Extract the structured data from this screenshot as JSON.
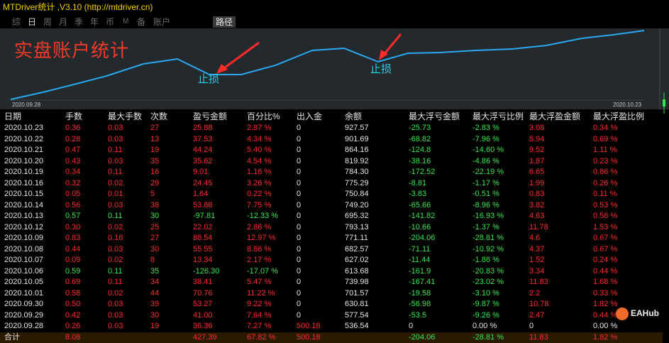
{
  "app_title": "MTDriver统计 ,V3.10 (http://mtdriver.cn)",
  "tabs": [
    "综",
    "日",
    "周",
    "月",
    "季",
    "年",
    "币",
    "M",
    "备",
    "账户",
    "路径"
  ],
  "active_tab": "日",
  "chart": {
    "title": "实盘账户统计",
    "stop_label_1": "止损",
    "stop_label_2": "止损",
    "start_date": "2020.09.28",
    "end_date": "2020.10.23",
    "line_color": "#2aa8f0",
    "arrow_color": "#ff2a2a"
  },
  "table": {
    "headers": [
      "日期",
      "手数",
      "最大手数",
      "次数",
      "盈亏金额",
      "百分比%",
      "出入金",
      "余额",
      "最大浮亏金额",
      "最大浮亏比例",
      "最大浮盈金额",
      "最大浮盈比例"
    ],
    "rows": [
      [
        "2020.10.23",
        "0.36",
        "0.03",
        "27",
        "25.88",
        "2.87 %",
        "0",
        "927.57",
        "-25.73",
        "-2.83 %",
        "3.08",
        "0.34 %"
      ],
      [
        "2020.10.22",
        "0.28",
        "0.03",
        "13",
        "37.53",
        "4.34 %",
        "0",
        "901.69",
        "-68.82",
        "-7.96 %",
        "5.94",
        "0.69 %"
      ],
      [
        "2020.10.21",
        "0.47",
        "0.11",
        "19",
        "44.24",
        "5.40 %",
        "0",
        "864.16",
        "-124.8",
        "-14.60 %",
        "9.52",
        "1.11 %"
      ],
      [
        "2020.10.20",
        "0.43",
        "0.03",
        "35",
        "35.62",
        "4.54 %",
        "0",
        "819.92",
        "-38.16",
        "-4.86 %",
        "1.87",
        "0.23 %"
      ],
      [
        "2020.10.19",
        "0.34",
        "0.11",
        "16",
        "9.01",
        "1.16 %",
        "0",
        "784.30",
        "-172.52",
        "-22.19 %",
        "6.65",
        "0.86 %"
      ],
      [
        "2020.10.16",
        "0.32",
        "0.02",
        "29",
        "24.45",
        "3.26 %",
        "0",
        "775.29",
        "-8.81",
        "-1.17 %",
        "1.99",
        "0.26 %"
      ],
      [
        "2020.10.15",
        "0.05",
        "0.01",
        "5",
        "1.64",
        "0.22 %",
        "0",
        "750.84",
        "-3.83",
        "-0.51 %",
        "0.83",
        "0.11 %"
      ],
      [
        "2020.10.14",
        "0.56",
        "0.03",
        "38",
        "53.88",
        "7.75 %",
        "0",
        "749.20",
        "-65.66",
        "-8.96 %",
        "3.82",
        "0.53 %"
      ],
      [
        "2020.10.13",
        "0.57",
        "0.11",
        "30",
        "-97.81",
        "-12.33 %",
        "0",
        "695.32",
        "-141.82",
        "-16.93 %",
        "4.63",
        "0.58 %"
      ],
      [
        "2020.10.12",
        "0.30",
        "0.02",
        "25",
        "22.02",
        "2.86 %",
        "0",
        "793.13",
        "-10.66",
        "-1.37 %",
        "11.78",
        "1.53 %"
      ],
      [
        "2020.10.09",
        "0.83",
        "0.16",
        "27",
        "88.54",
        "12.97 %",
        "0",
        "771.11",
        "-204.06",
        "-28.81 %",
        "4.6",
        "0.67 %"
      ],
      [
        "2020.10.08",
        "0.44",
        "0.03",
        "30",
        "55.55",
        "8.86 %",
        "0",
        "682.57",
        "-71.11",
        "-10.92 %",
        "4.37",
        "0.67 %"
      ],
      [
        "2020.10.07",
        "0.09",
        "0.02",
        "8",
        "13.34",
        "2.17 %",
        "0",
        "627.02",
        "-11.44",
        "-1.86 %",
        "1.52",
        "0.24 %"
      ],
      [
        "2020.10.06",
        "0.59",
        "0.11",
        "35",
        "-126.30",
        "-17.07 %",
        "0",
        "613.68",
        "-161.9",
        "-20.83 %",
        "3.34",
        "0.44 %"
      ],
      [
        "2020.10.05",
        "0.69",
        "0.11",
        "34",
        "38.41",
        "5.47 %",
        "0",
        "739.98",
        "-167.41",
        "-23.02 %",
        "11.83",
        "1.68 %"
      ],
      [
        "2020.10.01",
        "0.58",
        "0.02",
        "44",
        "70.76",
        "11.22 %",
        "0",
        "701.57",
        "-19.58",
        "-3.10 %",
        "2.2",
        "0.33 %"
      ],
      [
        "2020.09.30",
        "0.50",
        "0.03",
        "39",
        "53.27",
        "9.22 %",
        "0",
        "630.81",
        "-56.98",
        "-9.87 %",
        "10.78",
        "1.82 %"
      ],
      [
        "2020.09.29",
        "0.42",
        "0.03",
        "30",
        "41.00",
        "7.64 %",
        "0",
        "577.54",
        "-53.5",
        "-9.26 %",
        "2.47",
        "0.44 %"
      ],
      [
        "2020.09.28",
        "0.26",
        "0.03",
        "19",
        "36.36",
        "7.27 %",
        "500.18",
        "536.54",
        "0",
        "0.00 %",
        "0",
        "0.00 %"
      ]
    ],
    "total": [
      "合计",
      "8.08",
      "",
      "",
      "427.39",
      "67.82 %",
      "500.18",
      "",
      "-204.06",
      "-28.81 %",
      "11.83",
      "1.82 %"
    ]
  },
  "watermark": "EAHub"
}
